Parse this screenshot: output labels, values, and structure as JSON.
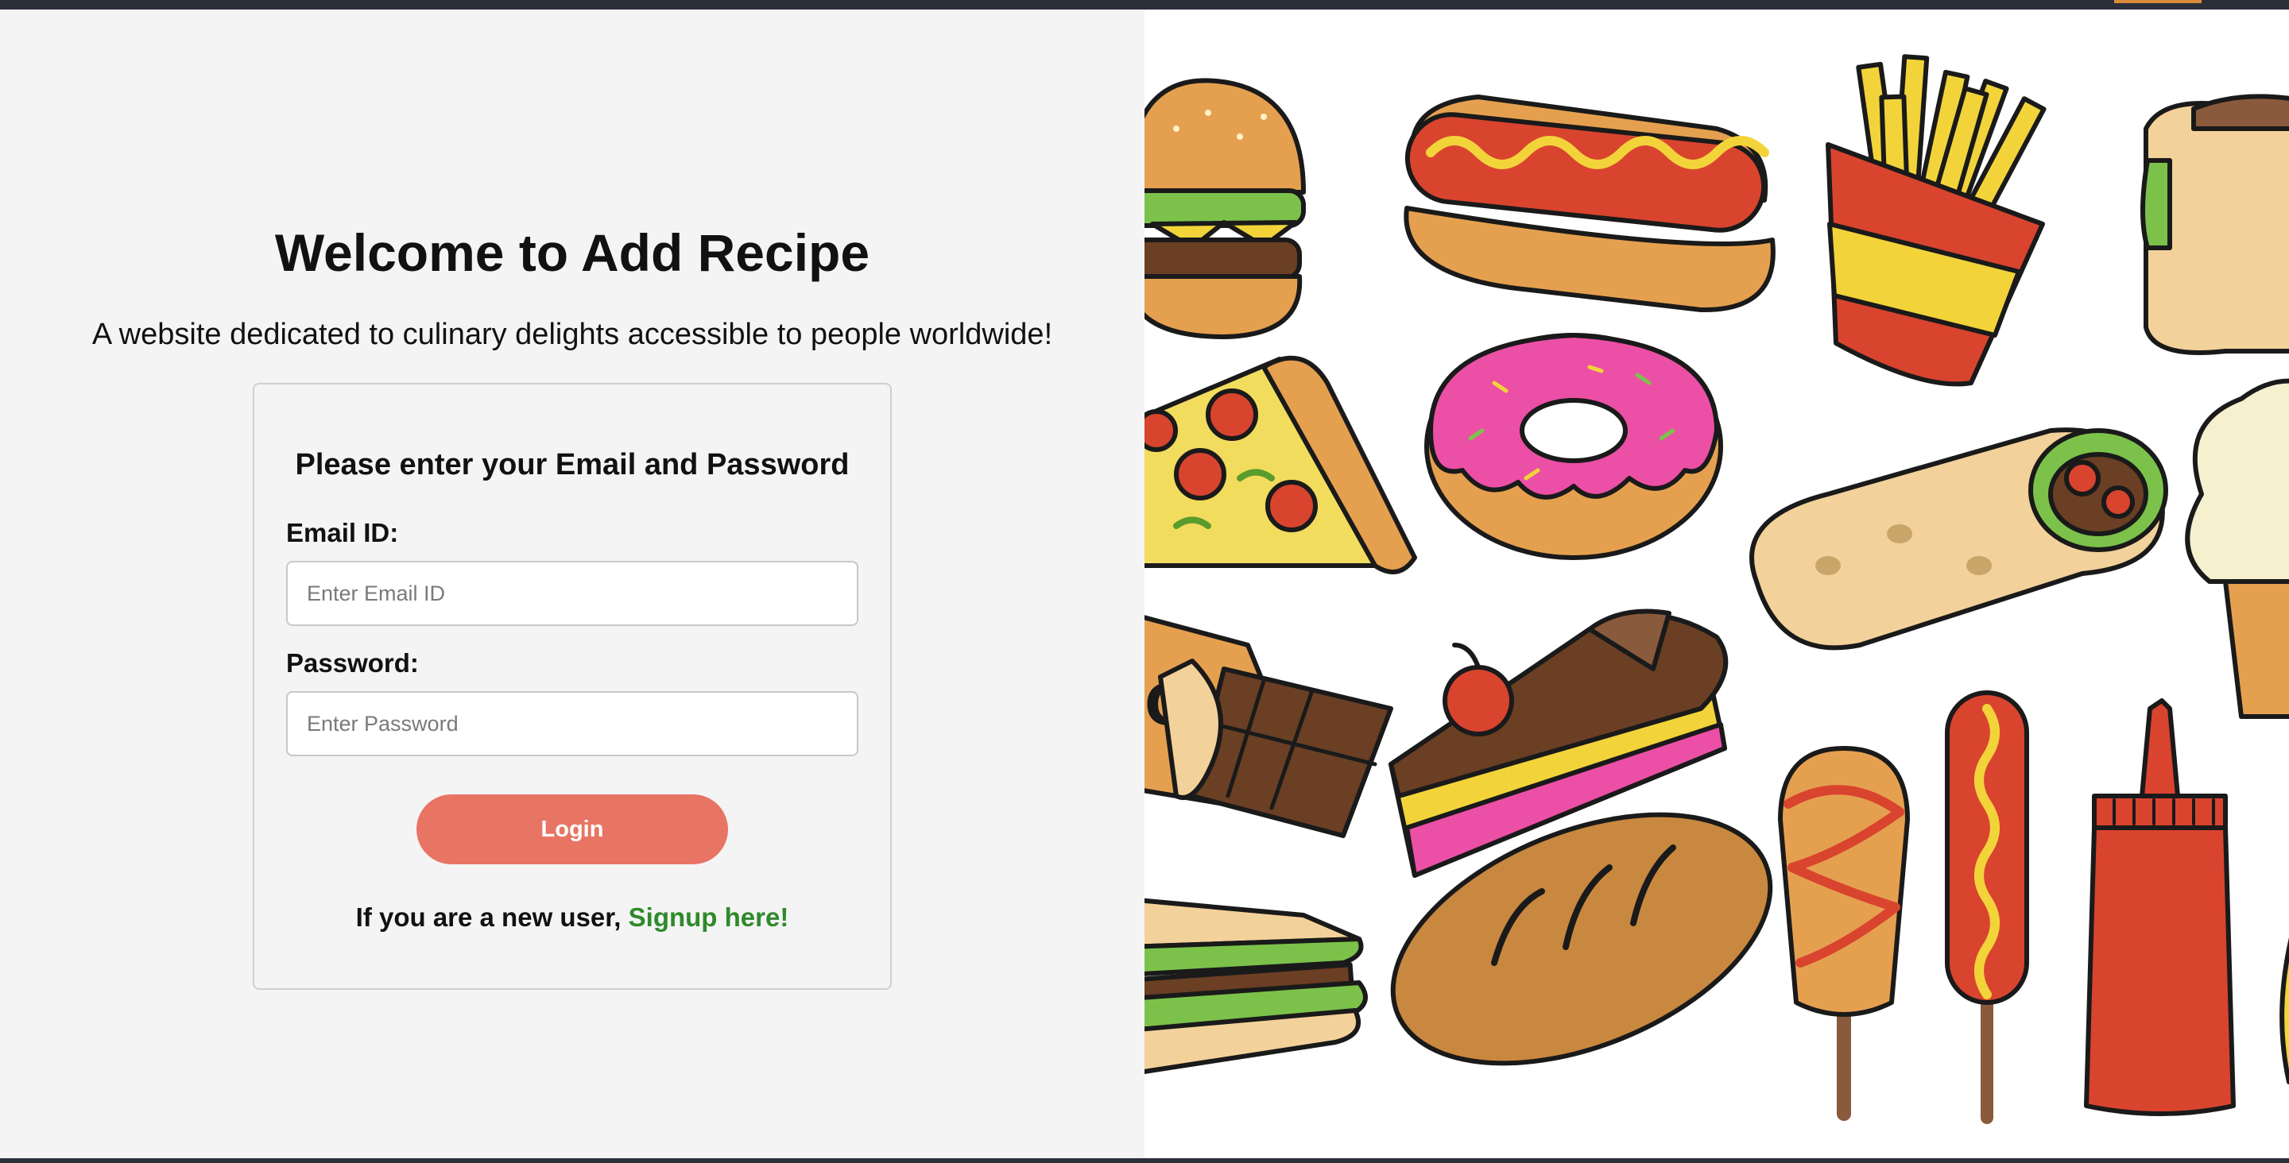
{
  "header": {
    "welcome_title": "Welcome to Add Recipe",
    "subtitle": "A website dedicated to culinary delights accessible to people worldwide!"
  },
  "login_form": {
    "heading": "Please enter your Email and Password",
    "email_label": "Email ID:",
    "email_placeholder": "Enter Email ID",
    "email_value": "",
    "password_label": "Password:",
    "password_placeholder": "Enter Password",
    "password_value": "",
    "login_button": "Login",
    "signup_prompt": "If you are a new user,",
    "signup_link": "Signup here!"
  },
  "colors": {
    "background": "#f4f4f4",
    "login_button": "#e87464",
    "signup_link": "#2e8a2a"
  },
  "illustration": {
    "icons": [
      "burger-icon",
      "hot-dog-icon",
      "fries-icon",
      "wrap-icon",
      "pizza-slice-icon",
      "donut-icon",
      "burrito-icon",
      "ice-cream-icon",
      "chocolate-bar-icon",
      "cake-slice-icon",
      "corn-dog-icon",
      "sausage-stick-icon",
      "ketchup-bottle-icon",
      "sandwich-icon",
      "bread-loaf-icon"
    ]
  }
}
